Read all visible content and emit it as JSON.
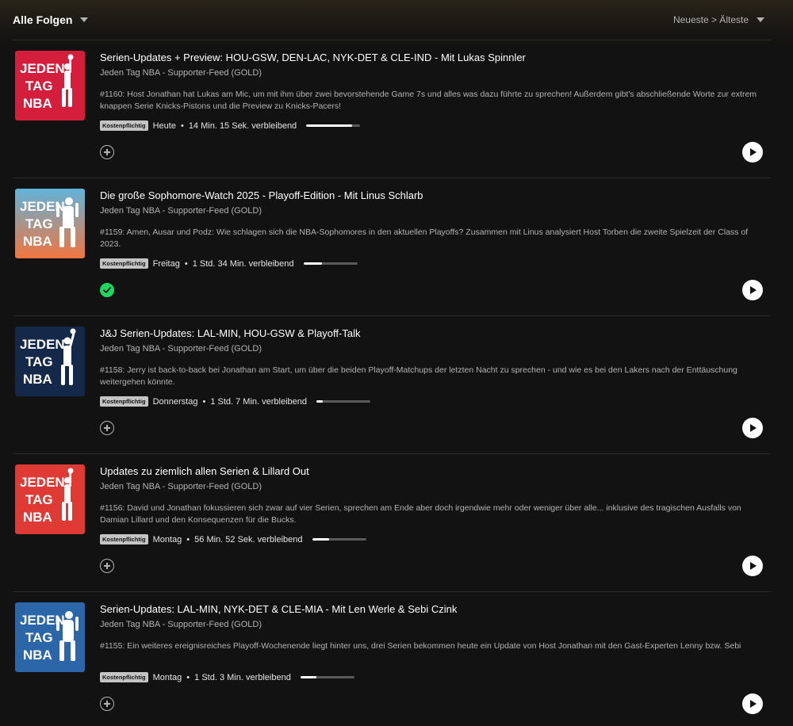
{
  "header": {
    "filter_label": "Alle Folgen",
    "sort_label": "Neueste > Älteste"
  },
  "cover_text": [
    "JEDEN",
    "TAG",
    "NBA"
  ],
  "episodes": [
    {
      "title": "Serien-Updates + Preview: HOU-GSW, DEN-LAC, NYK-DET & CLE-IND - Mit Lukas Spinnler",
      "show": "Jeden Tag NBA - Supporter-Feed (GOLD)",
      "description": "#1160: Host Jonathan hat Lukas am Mic, um mit ihm über zwei bevorstehende Game 7s und alles was dazu führte zu sprechen! Außerdem gibt's abschließende Worte zur extrem knappen Serie Knicks-Pistons und die Preview zu Knicks-Pacers!",
      "badge": "Kostenpflichtig",
      "date": "Heute",
      "remaining": "14 Min. 15 Sek. verbleibend",
      "progress": 0.85,
      "status": "add",
      "cover_style": "red",
      "cover_colors": [
        "#d41e3c",
        "#c8163a"
      ]
    },
    {
      "title": "Die große Sophomore-Watch 2025 - Playoff-Edition - Mit Linus Schlarb",
      "show": "Jeden Tag NBA - Supporter-Feed (GOLD)",
      "description": "#1159: Amen, Ausar und Podz: Wie schlagen sich die NBA-Sophomores in den aktuellen Playoffs? Zusammen mit Linus analysiert Host Torben die zweite Spielzeit der Class of 2023.",
      "badge": "Kostenpflichtig",
      "date": "Freitag",
      "remaining": "1 Std. 34 Min. verbleibend",
      "progress": 0.35,
      "status": "done",
      "cover_style": "gradient",
      "cover_colors": [
        "#5fb3d9",
        "#f2753e"
      ]
    },
    {
      "title": "J&J Serien-Updates: LAL-MIN, HOU-GSW & Playoff-Talk",
      "show": "Jeden Tag NBA - Supporter-Feed (GOLD)",
      "description": "#1158: Jerry ist back-to-back bei Jonathan am Start, um über die beiden Playoff-Matchups der letzten Nacht zu sprechen - und wie es bei den Lakers nach der Enttäuschung weitergehen könnte.",
      "badge": "Kostenpflichtig",
      "date": "Donnerstag",
      "remaining": "1 Std. 7 Min. verbleibend",
      "progress": 0.12,
      "status": "add",
      "cover_style": "navy",
      "cover_colors": [
        "#14284a",
        "#0f2242"
      ]
    },
    {
      "title": "Updates zu ziemlich allen Serien & Lillard Out",
      "show": "Jeden Tag NBA - Supporter-Feed (GOLD)",
      "description": "#1156: David und Jonathan fokussieren sich zwar auf vier Serien, sprechen am Ende aber doch irgendwie mehr oder weniger über alle... inklusive des tragischen Ausfalls von Damian Lillard und den Konsequenzen für die Bucks.",
      "badge": "Kostenpflichtig",
      "date": "Montag",
      "remaining": "56 Min. 52 Sek. verbleibend",
      "progress": 0.32,
      "status": "add",
      "cover_style": "red2",
      "cover_colors": [
        "#e03a35",
        "#d8302c"
      ]
    },
    {
      "title": "Serien-Updates: LAL-MIN, NYK-DET & CLE-MIA - Mit Len Werle & Sebi Czink",
      "show": "Jeden Tag NBA - Supporter-Feed (GOLD)",
      "description": "#1155: Ein weiteres ereignisreiches Playoff-Wochenende liegt hinter uns, drei Serien bekommen heute ein Update von Host Jonathan mit den Gast-Experten Lenny bzw. Sebi",
      "badge": "Kostenpflichtig",
      "date": "Montag",
      "remaining": "1 Std. 3 Min. verbleibend",
      "progress": 0.3,
      "status": "add",
      "cover_style": "blue",
      "cover_colors": [
        "#2a66a8",
        "#225c9c"
      ]
    }
  ]
}
